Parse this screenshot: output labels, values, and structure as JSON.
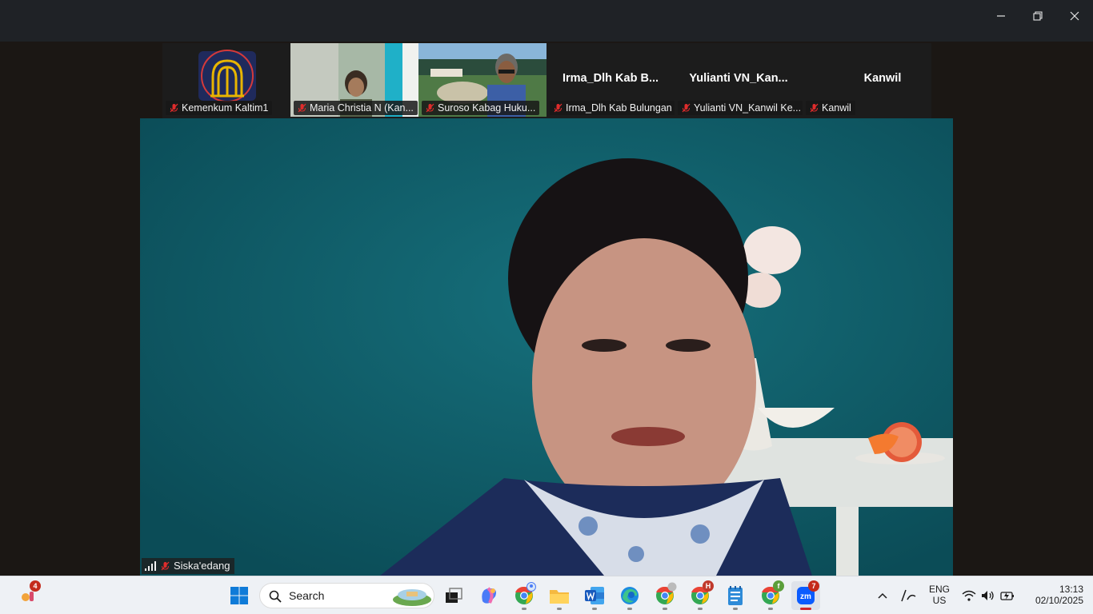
{
  "window": {
    "controls": [
      "minimize",
      "restore",
      "close"
    ]
  },
  "gallery": {
    "participants": [
      {
        "name": "Kemenkum Kaltim1",
        "muted": true,
        "display": "logo"
      },
      {
        "name": "Maria Christia N (Kan...",
        "muted": true,
        "display": "video"
      },
      {
        "name": "Suroso Kabag Huku...",
        "muted": true,
        "display": "video"
      },
      {
        "name": "Irma_Dlh Kab Bulungan",
        "muted": true,
        "display": "name",
        "big_name": "Irma_Dlh  Kab  B..."
      },
      {
        "name": "Yulianti VN_Kanwil Ke...",
        "muted": true,
        "display": "name",
        "big_name": "Yulianti  VN_Kan..."
      },
      {
        "name": "Kanwil",
        "muted": true,
        "display": "name",
        "big_name": "Kanwil"
      }
    ]
  },
  "active_speaker": {
    "name": "Siska'edang",
    "muted": true,
    "signal": "signal-bars-icon"
  },
  "taskbar": {
    "search_label": "Search",
    "weather_badge": "4",
    "chrome_badge": "H",
    "zoom_badge": "7",
    "chrome2_badge": "f",
    "language": "ENG",
    "region": "US",
    "time": "13:13",
    "date": "02/10/2025"
  },
  "colors": {
    "accent": "#0067c0",
    "mute_red": "#e02c2c",
    "teal_wall": "#0f5a66"
  }
}
